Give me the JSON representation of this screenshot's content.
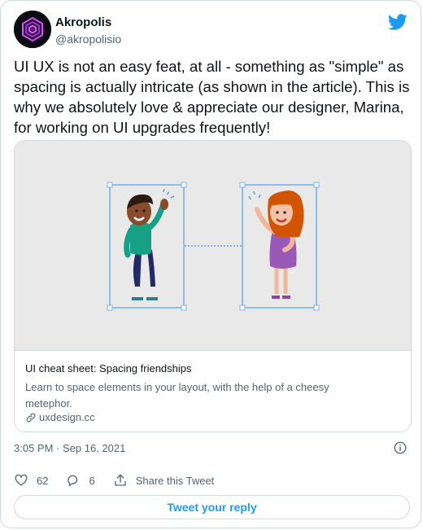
{
  "user": {
    "name": "Akropolis",
    "handle": "@akropolisio"
  },
  "tweet": {
    "text": "UI UX is not an easy feat, at all - something as \"simple\" as spacing is actually intricate (as shown in the article). This is why we absolutely love & appreciate our designer, Marina, for working on UI upgrades frequently!"
  },
  "card": {
    "title": "UI cheat sheet: Spacing friendships",
    "description": "Learn to space elements in your layout, with the help of a cheesy metephor.",
    "domain": "uxdesign.cc"
  },
  "meta": {
    "timestamp": "3:05 PM · Sep 16, 2021"
  },
  "actions": {
    "likes": "62",
    "replies": "6",
    "share_label": "Share this Tweet"
  },
  "reply_button": {
    "label": "Tweet your reply"
  },
  "colors": {
    "accent": "#1d9bf0",
    "text": "#0f1419",
    "muted": "#536471",
    "border": "#cfd9de",
    "avatar_glow": "#c026ff"
  },
  "icons": {
    "brand": "twitter-bird-icon",
    "like": "heart-icon",
    "reply": "comment-icon",
    "share": "share-icon",
    "link": "link-icon",
    "info": "info-icon"
  }
}
